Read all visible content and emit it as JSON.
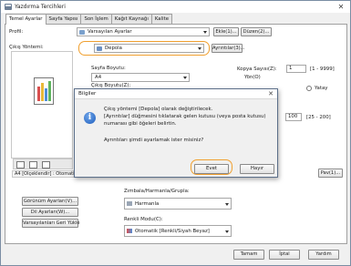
{
  "window": {
    "title": "Yazdırma Tercihleri",
    "close_glyph": "✕"
  },
  "tabs": [
    "Temel Ayarlar",
    "Sayfa Yapısı",
    "Son İşlem",
    "Kağıt Kaynağı",
    "Kalite"
  ],
  "profile": {
    "label": "Profil:",
    "value": "Varsayılan Ayarlar",
    "add_button": "Ekle(1)...",
    "edit_button": "Düzen(2)..."
  },
  "output": {
    "label": "Çıkış Yöntemi:",
    "value": "Depola",
    "settings_button": "Ayrıntılar(3)..."
  },
  "page_size": {
    "label": "Sayfa Boyutu:",
    "value": "A4",
    "label2": "Çıkış Boyutu(Z):"
  },
  "copies": {
    "label": "Kopya Sayısı(Z):",
    "value": "1",
    "range": "[1 - 9999]",
    "orientation_label": "Yön(O)",
    "portrait": "Yatay"
  },
  "zoom": {
    "value": "100",
    "range": "[25 - 200]"
  },
  "preview": {
    "caption": "A4 [Ölçeklendir] : Otomatik]"
  },
  "left_buttons": [
    "Görünüm Ayarları(V)...",
    "Dil Ayarları(W)...",
    "Varsayılanları Geri Yükle"
  ],
  "staple": {
    "label": "Zımbala/Harmanla/Grupla:",
    "value": "Harmanla"
  },
  "color": {
    "label": "Renkli Modu(C):",
    "value": "Otomatik [Renkli/Siyah Beyaz]"
  },
  "footer": {
    "ok": "Tamam",
    "cancel": "İptal",
    "help": "Yardım"
  },
  "right_small_button": "Pav(1)...",
  "dialog": {
    "title": "Bilgiler",
    "line1": "Çıkış yöntemi [Depola] olarak değiştirilecek.",
    "line2": "[Ayrıntılar] düğmesini tıklatarak gelen kutusu (veya posta kutusu)",
    "line3": "numarası gibi öğeleri belirtin.",
    "question": "Ayrıntıları şimdi ayarlamak ister misiniz?",
    "yes": "Evet",
    "no": "Hayır",
    "info_glyph": "i"
  },
  "colors": {
    "accent_ring": "#f0a030",
    "info_blue": "#1d5cbc"
  }
}
